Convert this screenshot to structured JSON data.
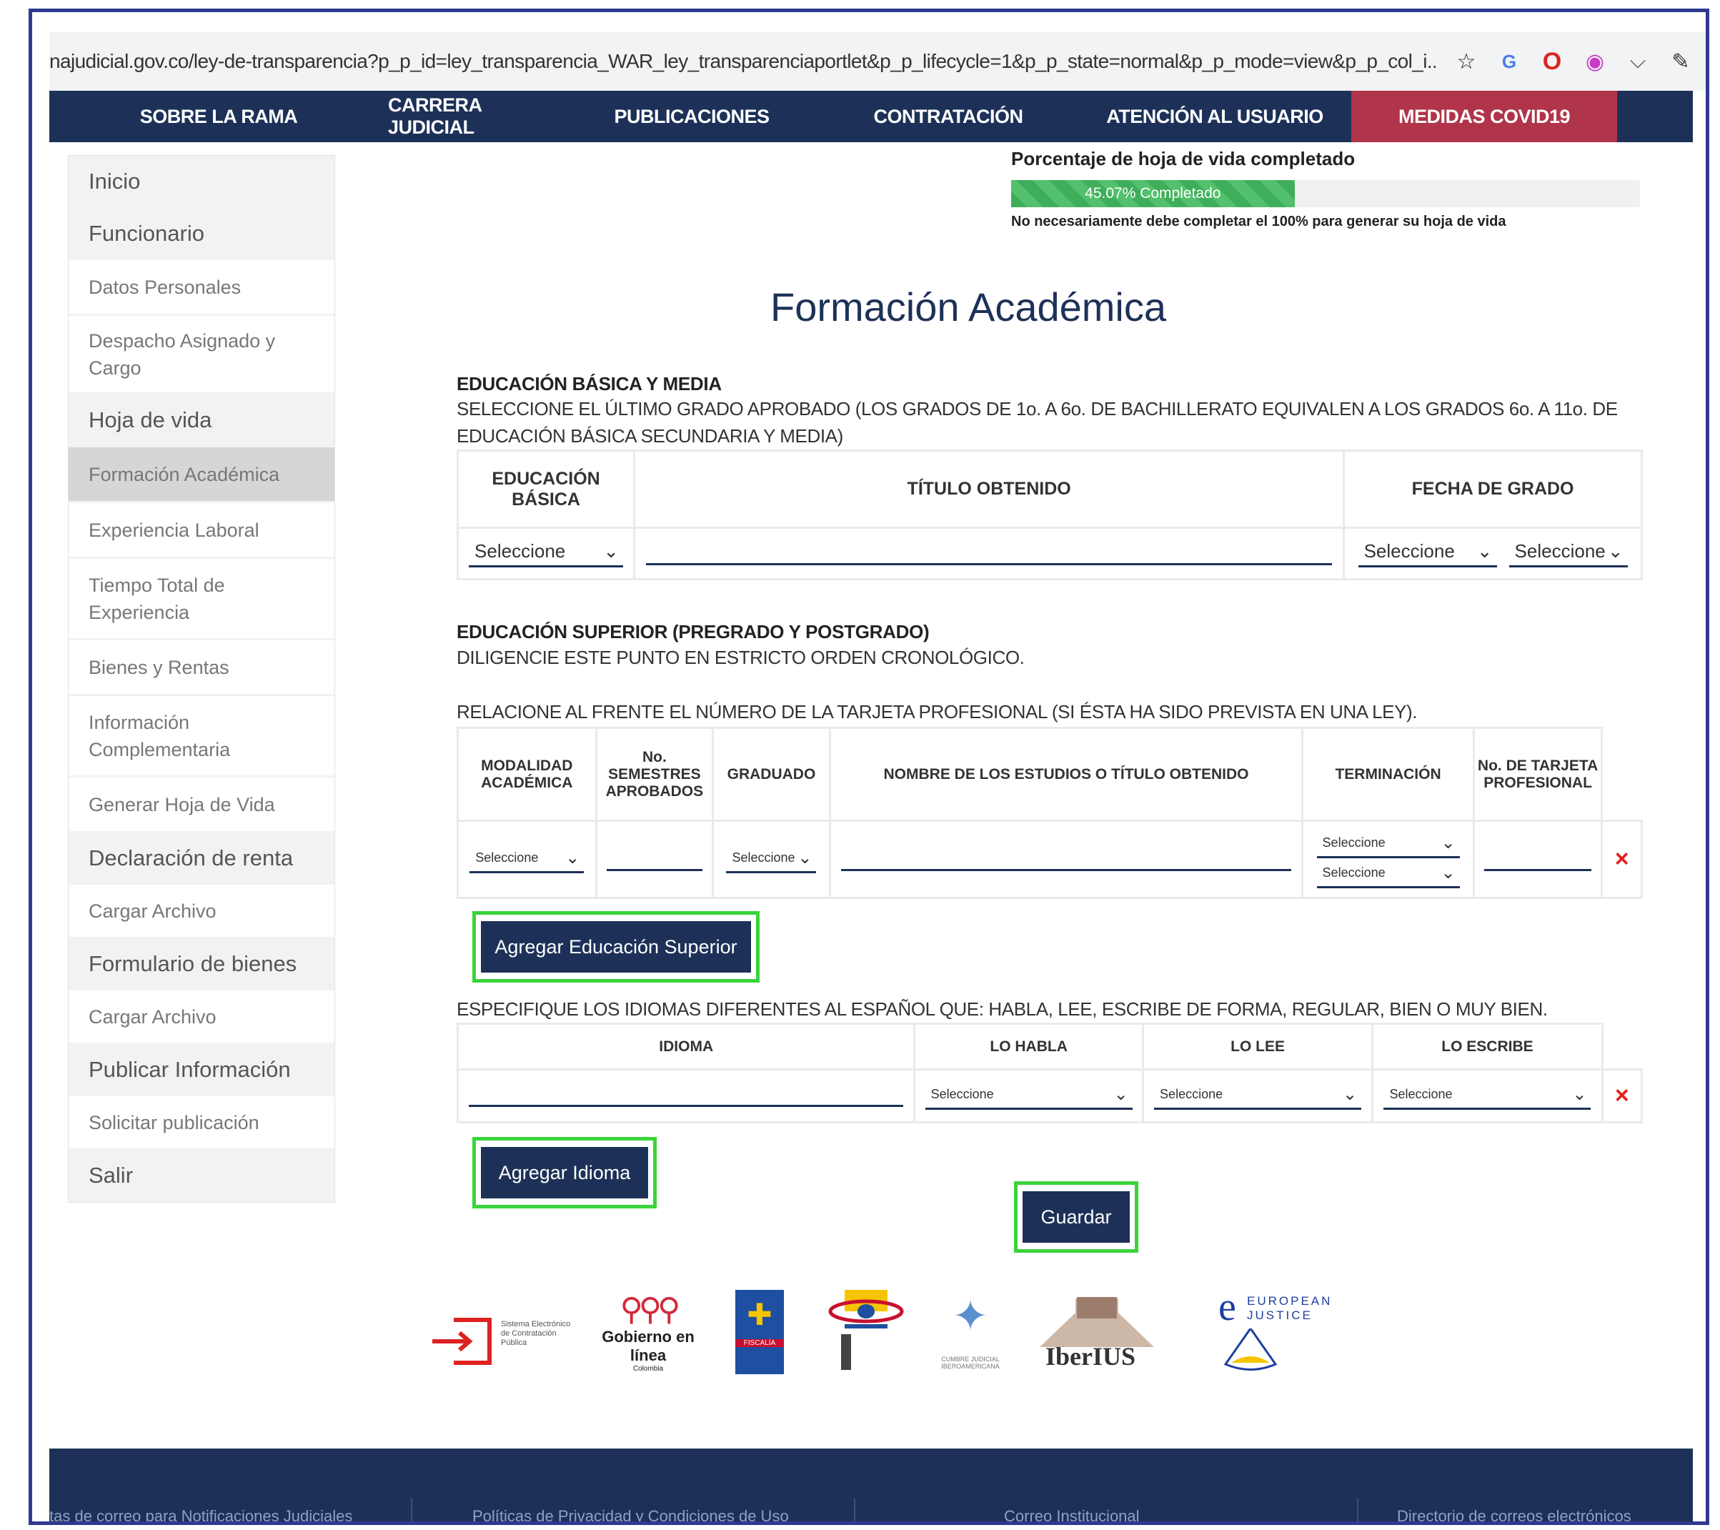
{
  "browser": {
    "url": "najudicial.gov.co/ley-de-transparencia?p_p_id=ley_transparencia_WAR_ley_transparenciaportlet&p_p_lifecycle=1&p_p_state=normal&p_p_mode=view&p_p_col_i...",
    "icons": [
      "star-icon",
      "translate-icon",
      "opera-icon",
      "extension-icon",
      "pocket-icon",
      "pen-icon"
    ]
  },
  "nav": {
    "items": [
      "SOBRE LA RAMA",
      "CARRERA JUDICIAL",
      "PUBLICACIONES",
      "CONTRATACIÓN",
      "ATENCIÓN AL USUARIO",
      "MEDIDAS COVID19"
    ],
    "colors": {
      "bg": "#1d3158",
      "covid": "#b0344a"
    }
  },
  "sidebar": {
    "items": [
      {
        "label": "Inicio",
        "type": "head"
      },
      {
        "label": "Funcionario",
        "type": "head"
      },
      {
        "label": "Datos Personales",
        "type": "item"
      },
      {
        "label": "Despacho Asignado y Cargo",
        "type": "item"
      },
      {
        "label": "Hoja de vida",
        "type": "head"
      },
      {
        "label": "Formación Académica",
        "type": "active"
      },
      {
        "label": "Experiencia Laboral",
        "type": "item"
      },
      {
        "label": "Tiempo Total de Experiencia",
        "type": "item"
      },
      {
        "label": "Bienes y Rentas",
        "type": "item"
      },
      {
        "label": "Información Complementaria",
        "type": "item"
      },
      {
        "label": "Generar Hoja de Vida",
        "type": "item"
      },
      {
        "label": "Declaración de renta",
        "type": "head"
      },
      {
        "label": "Cargar Archivo",
        "type": "item"
      },
      {
        "label": "Formulario de bienes",
        "type": "head"
      },
      {
        "label": "Cargar Archivo",
        "type": "item"
      },
      {
        "label": "Publicar Información",
        "type": "head"
      },
      {
        "label": "Solicitar publicación",
        "type": "item"
      },
      {
        "label": "Salir",
        "type": "head"
      }
    ]
  },
  "progress": {
    "title": "Porcentaje de hoja de vida completado",
    "label": "45.07% Completado",
    "value": 0.4507,
    "note": "No necesariamente debe completar el 100% para generar su hoja de vida"
  },
  "page_title": "Formación Académica",
  "basica": {
    "heading": "EDUCACIÓN BÁSICA Y MEDIA",
    "instructions": "SELECCIONE EL ÚLTIMO GRADO APROBADO (LOS GRADOS DE 1o. A 6o. DE BACHILLERATO EQUIVALEN A LOS GRADOS 6o. A 11o. DE EDUCACIÓN BÁSICA SECUNDARIA Y MEDIA)",
    "headers": [
      "EDUCACIÓN BÁSICA",
      "TÍTULO OBTENIDO",
      "FECHA DE GRADO"
    ],
    "select_value": "Seleccione"
  },
  "superior": {
    "heading": "EDUCACIÓN SUPERIOR (PREGRADO Y POSTGRADO)",
    "line1": "DILIGENCIE ESTE PUNTO EN ESTRICTO ORDEN CRONOLÓGICO.",
    "line2": "RELACIONE AL FRENTE EL NÚMERO DE LA TARJETA PROFESIONAL (SI ÉSTA HA SIDO PREVISTA EN UNA LEY).",
    "headers": [
      "MODALIDAD ACADÉMICA",
      "No. SEMESTRES APROBADOS",
      "GRADUADO",
      "NOMBRE DE LOS ESTUDIOS O TÍTULO OBTENIDO",
      "TERMINACIÓN",
      "No. DE TARJETA PROFESIONAL"
    ],
    "select_value": "Seleccione",
    "add_button": "Agregar Educación Superior"
  },
  "idiomas": {
    "instructions": "ESPECIFIQUE LOS IDIOMAS DIFERENTES AL ESPAÑOL QUE: HABLA, LEE, ESCRIBE DE FORMA, REGULAR, BIEN O MUY BIEN.",
    "headers": [
      "IDIOMA",
      "LO HABLA",
      "LO LEE",
      "LO ESCRIBE"
    ],
    "select_value": "Seleccione",
    "add_button": "Agregar Idioma"
  },
  "save_button": "Guardar",
  "remove_glyph": "×",
  "logos": {
    "secop": "Sistema Electrónico de Contratación Pública",
    "gel": "Gobierno en línea",
    "gel_sub": "Colombia",
    "fiscalia": "FISCALÍA",
    "iberius": "IberIUS",
    "cumbre": "CUMBRE JUDICIAL IBEROAMERICANA",
    "ejustice_e": "e",
    "ejustice": "EUROPEAN JUSTICE"
  },
  "footer": {
    "links": [
      "tas de correo para Notificaciones Judiciales",
      "Políticas de Privacidad y Condiciones de Uso",
      "Correo Institucional",
      "Directorio de correos electrónicos"
    ]
  }
}
